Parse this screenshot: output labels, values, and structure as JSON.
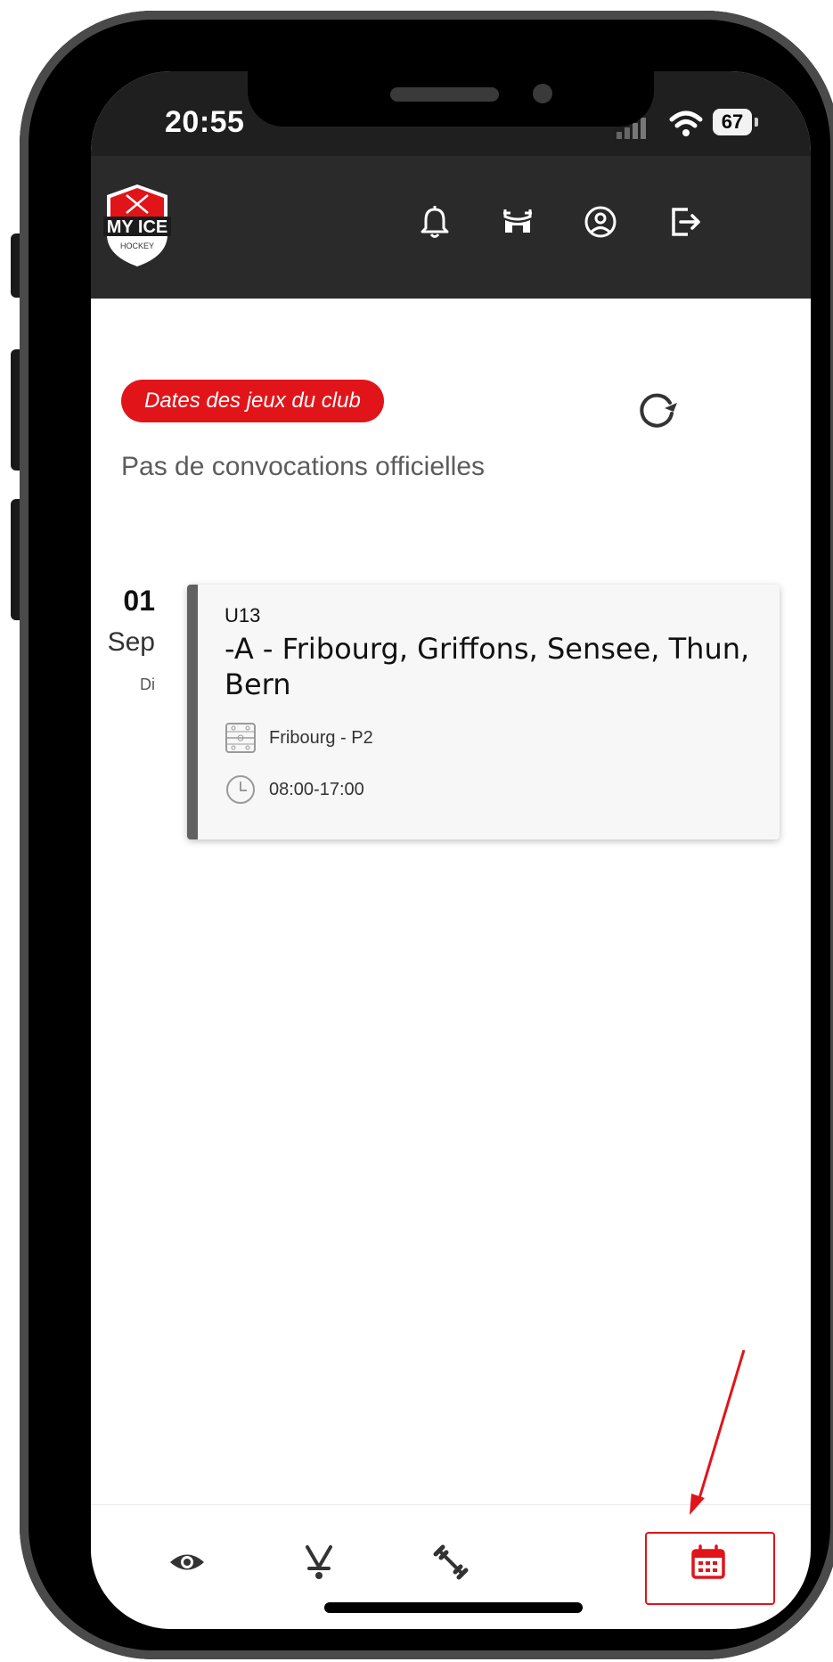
{
  "status_bar": {
    "time": "20:55",
    "battery": "67"
  },
  "header": {
    "logo_text": "MY ICE",
    "logo_subtext": "HOCKEY",
    "icons": [
      "bell-icon",
      "arena-icon",
      "user-circle-icon",
      "logout-icon"
    ]
  },
  "content": {
    "club_pill": "Dates des jeux du club",
    "no_convocations": "Pas de convocations officielles"
  },
  "event": {
    "day": "01",
    "month": "Sep",
    "weekday": "Di",
    "category": "U13",
    "title": "-A - Fribourg, Griffons, Sensee, Thun, Bern",
    "location": "Fribourg - P2",
    "time": "08:00-17:00",
    "accent_color": "#616161"
  },
  "nav": {
    "items": [
      "eye-icon",
      "hockey-sticks-icon",
      "dumbbell-icon",
      "calendar-icon"
    ],
    "active_index": 3,
    "active_color": "#e1141a"
  },
  "colors": {
    "brand_red": "#e1141a",
    "header_bg": "#2a2a2a"
  }
}
